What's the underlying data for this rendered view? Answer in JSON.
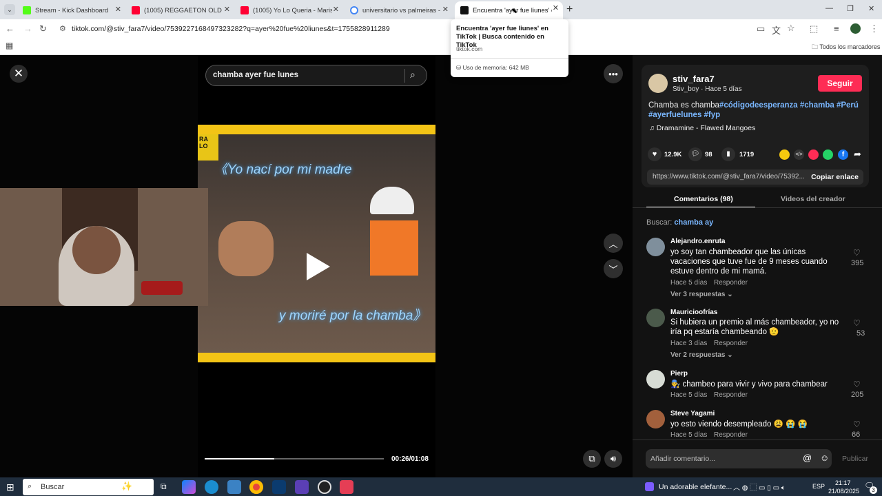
{
  "tabs": [
    {
      "title": "Stream - Kick Dashboard",
      "color": "#53fc18"
    },
    {
      "title": "(1005) REGGAETON OLD SCHO",
      "color": "#ff0033"
    },
    {
      "title": "(1005) Yo Lo Queria - Marisol Y",
      "color": "#ff0033"
    },
    {
      "title": "universitario vs palmeiras - Bus",
      "color": "#4285f4"
    },
    {
      "title": "Encuentra 'ayer fue liunes' en T",
      "color": "#111111"
    }
  ],
  "browser": {
    "url": "tiktok.com/@stiv_fara7/video/7539227168497323282?q=ayer%20fue%20liunes&t=1755828911289",
    "bookmarks": "Todos los marcadores"
  },
  "tooltip": {
    "title": "Encuentra 'ayer fue liunes' en TikTok | Busca contenido en TikTok",
    "domain": "tiktok.com",
    "memory": "Uso de memoria: 642 MB"
  },
  "player": {
    "search": "chamba ayer fue lunes",
    "time": "00:26/01:08",
    "progress": 0.39,
    "caption1": "《Yo nací por mi madre",
    "caption2": "y moriré por la chamba》"
  },
  "post": {
    "username": "stiv_fara7",
    "subline": "Stiv_boy · Hace 5 días",
    "follow": "Seguir",
    "desc": "Chamba es chamba",
    "tags": "#códigodeesperanza #chamba #Perú #ayerfuelunes #fyp",
    "music": "Dramamine - Flawed Mangoes",
    "likes": "12.9K",
    "comments": "98",
    "saves": "1719",
    "link": "https://www.tiktok.com/@stiv_fara7/video/75392...",
    "copy": "Copiar enlace"
  },
  "tabs2": {
    "comments": "Comentarios (98)",
    "videos": "Videos del creador"
  },
  "search_label": "Buscar:",
  "search_term": "chamba ay",
  "comments": [
    {
      "user": "Alejandro.enruta",
      "text": "yo soy tan chambeador que las únicas vacaciones que tuve fue de 9 meses cuando estuve dentro de mi mamá.",
      "time": "Hace 5 días",
      "reply": "Responder",
      "likes": "395",
      "more": "Ver 3 respuestas"
    },
    {
      "user": "Mauricioofrías",
      "text": "Si hubiera un premio al más chambeador, yo no iría pq estaría chambeando 🫡",
      "time": "Hace 3 días",
      "reply": "Responder",
      "likes": "53",
      "more": "Ver 2 respuestas"
    },
    {
      "user": "Pierp",
      "text": "👨‍🔧 chambeo para vivir y vivo para chambear",
      "time": "Hace 5 días",
      "reply": "Responder",
      "likes": "205"
    },
    {
      "user": "Steve Yagami",
      "text": "yo esto viendo desempleado 😩 😭 😭",
      "time": "Hace 5 días",
      "reply": "Responder",
      "likes": "66"
    }
  ],
  "add_comment": {
    "placeholder": "Añadir comentario...",
    "publish": "Publicar"
  },
  "taskbar": {
    "search": "Buscar",
    "weather": "Un adorable elefante...",
    "lang": "ESP",
    "time": "21:17",
    "date": "21/08/2025",
    "notif": "3"
  }
}
